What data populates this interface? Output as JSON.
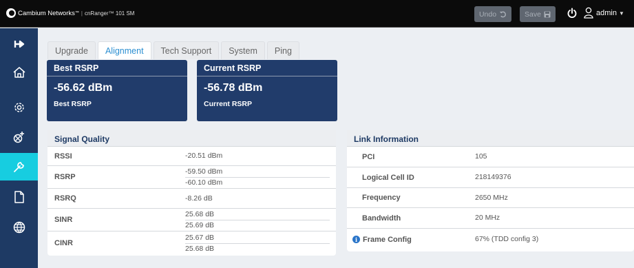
{
  "topbar": {
    "brand_name": "Cambium Networks",
    "brand_tm": "™",
    "separator": "|",
    "product": "cnRanger™ 101 SM",
    "undo_label": "Undo",
    "save_label": "Save",
    "user": "admin",
    "icons": {
      "undo": "undo-icon",
      "save": "floppy-icon",
      "power": "power-icon",
      "user": "user-icon"
    }
  },
  "sidebar": {
    "items": [
      {
        "name": "pin",
        "icon": "pin-icon"
      },
      {
        "name": "home",
        "icon": "home-icon"
      },
      {
        "name": "settings",
        "icon": "gear-icon"
      },
      {
        "name": "network",
        "icon": "network-icon"
      },
      {
        "name": "tools",
        "icon": "wrench-icon",
        "active": true
      },
      {
        "name": "file",
        "icon": "file-icon"
      },
      {
        "name": "globe",
        "icon": "globe-icon"
      }
    ],
    "active_color": "#17cde0",
    "bg_color": "#1e3a64"
  },
  "tabs": [
    {
      "label": "Upgrade"
    },
    {
      "label": "Alignment",
      "active": true
    },
    {
      "label": "Tech Support"
    },
    {
      "label": "System"
    },
    {
      "label": "Ping"
    }
  ],
  "best_rsrp": {
    "header": "Best RSRP",
    "value": "-56.62 dBm",
    "caption": "Best RSRP"
  },
  "current_rsrp": {
    "header": "Current RSRP",
    "value": "-56.78 dBm",
    "caption": "Current RSRP"
  },
  "signal_quality": {
    "title": "Signal Quality",
    "rows": [
      {
        "label": "RSSI",
        "values": [
          "-20.51 dBm"
        ]
      },
      {
        "label": "RSRP",
        "values": [
          "-59.50 dBm",
          "-60.10 dBm"
        ]
      },
      {
        "label": "RSRQ",
        "values": [
          "-8.26 dB"
        ]
      },
      {
        "label": "SINR",
        "values": [
          "25.68 dB",
          "25.69 dB"
        ]
      },
      {
        "label": "CINR",
        "values": [
          "25.67 dB",
          "25.68 dB"
        ]
      }
    ]
  },
  "link_information": {
    "title": "Link Information",
    "rows": [
      {
        "label": "PCI",
        "value": "105"
      },
      {
        "label": "Logical Cell ID",
        "value": "218149376"
      },
      {
        "label": "Frequency",
        "value": "2650 MHz"
      },
      {
        "label": "Bandwidth",
        "value": "20 MHz"
      },
      {
        "label": "Frame Config",
        "value": "67% (TDD config 3)",
        "info_icon": true
      }
    ]
  }
}
